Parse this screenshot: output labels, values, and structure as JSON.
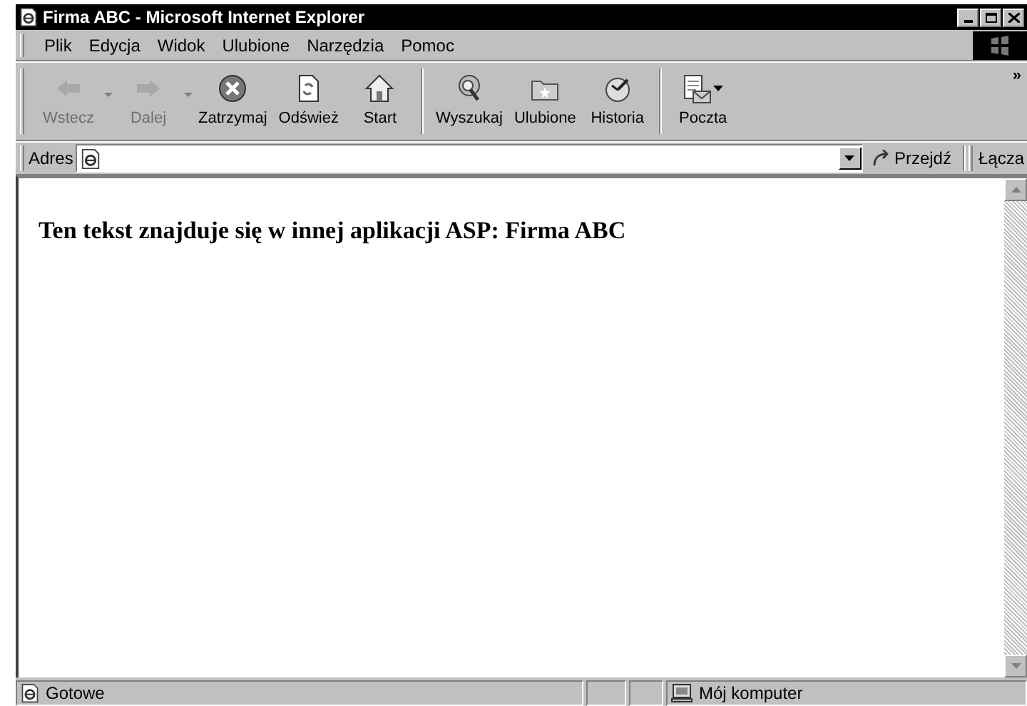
{
  "window": {
    "title": "Firma ABC - Microsoft Internet Explorer"
  },
  "menu": [
    "Plik",
    "Edycja",
    "Widok",
    "Ulubione",
    "Narzędzia",
    "Pomoc"
  ],
  "toolbar": [
    {
      "kind": "back",
      "label": "Wstecz",
      "disabled": true,
      "dropdown": true,
      "separator_before": false
    },
    {
      "kind": "forward",
      "label": "Dalej",
      "disabled": true,
      "dropdown": true,
      "separator_before": false
    },
    {
      "kind": "stop",
      "label": "Zatrzymaj",
      "disabled": false,
      "dropdown": false,
      "separator_before": false
    },
    {
      "kind": "refresh",
      "label": "Odśwież",
      "disabled": false,
      "dropdown": false,
      "separator_before": false
    },
    {
      "kind": "home",
      "label": "Start",
      "disabled": false,
      "dropdown": false,
      "separator_before": false
    },
    {
      "kind": "search",
      "label": "Wyszukaj",
      "disabled": false,
      "dropdown": false,
      "separator_before": true
    },
    {
      "kind": "favorites",
      "label": "Ulubione",
      "disabled": false,
      "dropdown": false,
      "separator_before": false
    },
    {
      "kind": "history",
      "label": "Historia",
      "disabled": false,
      "dropdown": false,
      "separator_before": false
    },
    {
      "kind": "mail",
      "label": "Poczta",
      "disabled": false,
      "dropdown": true,
      "separator_before": true
    }
  ],
  "toolbar_more": "»",
  "address": {
    "label": "Adres",
    "go": "Przejdź",
    "links": "Łącza"
  },
  "content": {
    "text": "Ten tekst znajduje się w innej aplikacji ASP: Firma ABC"
  },
  "status_bar": {
    "text": "Gotowe",
    "zone": "Mój komputer"
  }
}
